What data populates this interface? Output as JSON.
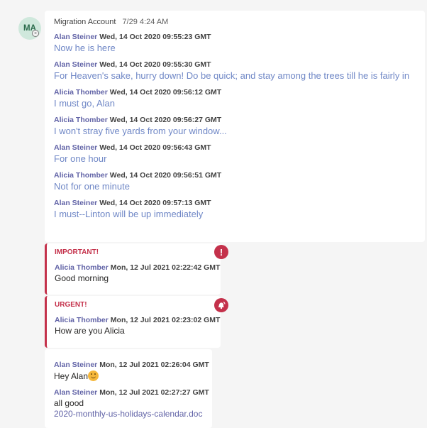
{
  "avatar": {
    "initials": "MA"
  },
  "thread": {
    "sender": "Migration Account",
    "time": "7/29 4:24 AM",
    "messages": [
      {
        "author": "Alan Steiner",
        "timestamp": "Wed, 14 Oct 2020 09:55:23 GMT",
        "text": "Now he is here"
      },
      {
        "author": "Alan Steiner",
        "timestamp": "Wed, 14 Oct 2020 09:55:30 GMT",
        "text": "For Heaven's sake, hurry down! Do be quick; and stay among the trees till he is fairly in"
      },
      {
        "author": "Alicia Thomber",
        "timestamp": "Wed, 14 Oct 2020 09:56:12 GMT",
        "text": "I must go, Alan"
      },
      {
        "author": "Alicia Thomber",
        "timestamp": "Wed, 14 Oct 2020 09:56:27 GMT",
        "text": "I won't stray five yards from your window..."
      },
      {
        "author": "Alan Steiner",
        "timestamp": "Wed, 14 Oct 2020 09:56:43 GMT",
        "text": "For one hour"
      },
      {
        "author": "Alicia Thomber",
        "timestamp": "Wed, 14 Oct 2020 09:56:51 GMT",
        "text": "Not for one minute"
      },
      {
        "author": "Alan Steiner",
        "timestamp": "Wed, 14 Oct 2020 09:57:13 GMT",
        "text": "I must--Linton will be up immediately"
      }
    ]
  },
  "important": {
    "label": "IMPORTANT!",
    "icon": "exclamation-icon",
    "author": "Alicia Thomber",
    "timestamp": "Mon, 12 Jul 2021 02:22:42 GMT",
    "text": "Good morning"
  },
  "urgent": {
    "label": "URGENT!",
    "icon": "bell-ring-icon",
    "author": "Alicia Thomber",
    "timestamp": "Mon, 12 Jul 2021 02:23:02 GMT",
    "text": "How are you Alicia"
  },
  "last": {
    "messages": [
      {
        "author": "Alan Steiner",
        "timestamp": "Mon, 12 Jul 2021 02:26:04 GMT",
        "text": "Hey Alan",
        "emoji": "smile-emoji"
      },
      {
        "author": "Alan Steiner",
        "timestamp": "Mon, 12 Jul 2021 02:27:27 GMT",
        "text": "all good",
        "attachment": "2020-monthly-us-holidays-calendar.doc"
      }
    ]
  },
  "colors": {
    "accent": "#6264a7",
    "urgent": "#c4314b",
    "message_text": "#6f87c6"
  }
}
